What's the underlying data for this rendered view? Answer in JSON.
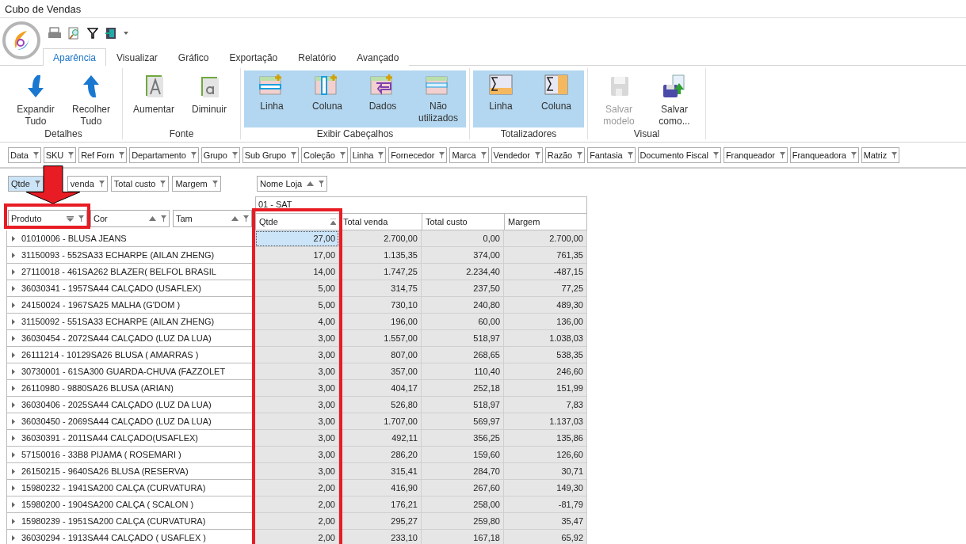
{
  "window": {
    "title": "Cubo de Vendas"
  },
  "tabs": [
    {
      "label": "Aparência",
      "selected": true
    },
    {
      "label": "Visualizar",
      "selected": false
    },
    {
      "label": "Gráfico",
      "selected": false
    },
    {
      "label": "Exportação",
      "selected": false
    },
    {
      "label": "Relatório",
      "selected": false
    },
    {
      "label": "Avançado",
      "selected": false
    }
  ],
  "ribbon_groups": [
    {
      "label": "Detalhes",
      "buttons": [
        {
          "kind": "expand",
          "label": "Expandir Tudo",
          "selected": false,
          "disabled": false
        },
        {
          "kind": "collapse",
          "label": "Recolher Tudo",
          "selected": false,
          "disabled": false
        }
      ]
    },
    {
      "label": "Fonte",
      "buttons": [
        {
          "kind": "font-up",
          "label": "Aumentar",
          "selected": false,
          "disabled": false
        },
        {
          "kind": "font-down",
          "label": "Diminuir",
          "selected": false,
          "disabled": false
        }
      ]
    },
    {
      "label": "Exibir Cabeçalhos",
      "buttons": [
        {
          "kind": "grid-row",
          "label": "Linha",
          "selected": true,
          "disabled": false
        },
        {
          "kind": "grid-col",
          "label": "Coluna",
          "selected": true,
          "disabled": false
        },
        {
          "kind": "grid-data",
          "label": "Dados",
          "selected": true,
          "disabled": false
        },
        {
          "kind": "grid-unused",
          "label": "Não utilizados",
          "selected": true,
          "disabled": false
        }
      ]
    },
    {
      "label": "Totalizadores",
      "buttons": [
        {
          "kind": "sum-row",
          "label": "Linha",
          "selected": true,
          "disabled": false
        },
        {
          "kind": "sum-col",
          "label": "Coluna",
          "selected": true,
          "disabled": false
        }
      ]
    },
    {
      "label": "Visual",
      "buttons": [
        {
          "kind": "save",
          "label": "Salvar modelo",
          "selected": false,
          "disabled": true
        },
        {
          "kind": "save-as",
          "label": "Salvar como...",
          "selected": false,
          "disabled": false
        }
      ]
    }
  ],
  "filter_fields": [
    "Data",
    "SKU",
    "Ref Forn",
    "Departamento",
    "Grupo",
    "Sub Grupo",
    "Coleção",
    "Linha",
    "Fornecedor",
    "Marca",
    "Vendedor",
    "Razão",
    "Fantasia",
    "Documento Fiscal",
    "Franqueador",
    "Franqueadora",
    "Matriz"
  ],
  "data_fields": [
    {
      "label": "Qtde",
      "selected": true
    },
    {
      "label": "venda",
      "selected": false
    },
    {
      "label": "Total custo",
      "selected": false
    },
    {
      "label": "Margem",
      "selected": false
    }
  ],
  "column_fields": [
    {
      "label": "Nome Loja",
      "descending": false
    }
  ],
  "row_fields": [
    {
      "label": "Produto",
      "descending": true
    },
    {
      "label": "Cor",
      "descending": false
    },
    {
      "label": "Tam",
      "descending": false
    }
  ],
  "column_value": "01 - SAT",
  "data_headers": [
    {
      "label": "Qtde",
      "sorted": true
    },
    {
      "label": "Total venda",
      "sorted": false
    },
    {
      "label": "Total custo",
      "sorted": false
    },
    {
      "label": "Margem",
      "sorted": false
    }
  ],
  "rows": [
    {
      "product": "01010006 - BLUSA JEANS",
      "expanded": false,
      "values": [
        "27,00",
        "2.700,00",
        "0,00",
        "2.700,00"
      ],
      "selected": true
    },
    {
      "product": "31150093 - 552SA33 ECHARPE (AILAN ZHENG)",
      "expanded": false,
      "values": [
        "17,00",
        "1.135,35",
        "374,00",
        "761,35"
      ],
      "selected": false
    },
    {
      "product": "27110018 - 461SA262 BLAZER( BELFOL BRASIL",
      "expanded": false,
      "values": [
        "14,00",
        "1.747,25",
        "2.234,40",
        "-487,15"
      ],
      "selected": false
    },
    {
      "product": "36030341 - 1957SA44 CALÇADO (USAFLEX)",
      "expanded": false,
      "values": [
        "5,00",
        "314,75",
        "237,50",
        "77,25"
      ],
      "selected": false
    },
    {
      "product": "24150024 - 1967SA25 MALHA (G'DOM )",
      "expanded": false,
      "values": [
        "5,00",
        "730,10",
        "240,80",
        "489,30"
      ],
      "selected": false
    },
    {
      "product": "31150092 - 551SA33 ECHARPE (AILAN ZHENG)",
      "expanded": false,
      "values": [
        "4,00",
        "196,00",
        "60,00",
        "136,00"
      ],
      "selected": false
    },
    {
      "product": "36030454 - 2072SA44 CALÇADO (LUZ DA LUA)",
      "expanded": false,
      "values": [
        "3,00",
        "1.557,00",
        "518,97",
        "1.038,03"
      ],
      "selected": false
    },
    {
      "product": "26111214 - 10129SA26 BLUSA ( AMARRAS )",
      "expanded": false,
      "values": [
        "3,00",
        "807,00",
        "268,65",
        "538,35"
      ],
      "selected": false
    },
    {
      "product": "30730001 - 61SA300 GUARDA-CHUVA (FAZZOLET",
      "expanded": false,
      "values": [
        "3,00",
        "357,00",
        "110,40",
        "246,60"
      ],
      "selected": false
    },
    {
      "product": "26110980 - 9880SA26 BLUSA (ARIAN)",
      "expanded": false,
      "values": [
        "3,00",
        "404,17",
        "252,18",
        "151,99"
      ],
      "selected": false
    },
    {
      "product": "36030406 - 2025SA44 CALÇADO (LUZ DA LUA)",
      "expanded": false,
      "values": [
        "3,00",
        "526,80",
        "518,97",
        "7,83"
      ],
      "selected": false
    },
    {
      "product": "36030450 - 2069SA44 CALÇADO (LUZ DA LUA)",
      "expanded": false,
      "values": [
        "3,00",
        "1.707,00",
        "569,97",
        "1.137,03"
      ],
      "selected": false
    },
    {
      "product": "36030391 - 2011SA44 CALÇADO(USAFLEX)",
      "expanded": false,
      "values": [
        "3,00",
        "492,11",
        "356,25",
        "135,86"
      ],
      "selected": false
    },
    {
      "product": "57150016 - 33B8 PIJAMA ( ROSEMARI )",
      "expanded": false,
      "values": [
        "3,00",
        "286,20",
        "159,60",
        "126,60"
      ],
      "selected": false
    },
    {
      "product": "26150215 - 9640SA26 BLUSA (RESERVA)",
      "expanded": false,
      "values": [
        "3,00",
        "315,41",
        "284,70",
        "30,71"
      ],
      "selected": false
    },
    {
      "product": "15980232 - 1941SA200 CALÇA (CURVATURA)",
      "expanded": false,
      "values": [
        "2,00",
        "416,90",
        "267,60",
        "149,30"
      ],
      "selected": false
    },
    {
      "product": "15980200 - 1904SA200 CALÇA ( SCALON )",
      "expanded": false,
      "values": [
        "2,00",
        "176,21",
        "258,00",
        "-81,79"
      ],
      "selected": false
    },
    {
      "product": "15980239 - 1951SA200 CALÇA (CURVATURA)",
      "expanded": false,
      "values": [
        "2,00",
        "295,27",
        "259,80",
        "35,47"
      ],
      "selected": false
    },
    {
      "product": "36030294 - 1913SA44 CALÇADO ( USAFLEX )",
      "expanded": false,
      "values": [
        "2,00",
        "233,10",
        "167,18",
        "65,92"
      ],
      "selected": false
    }
  ]
}
